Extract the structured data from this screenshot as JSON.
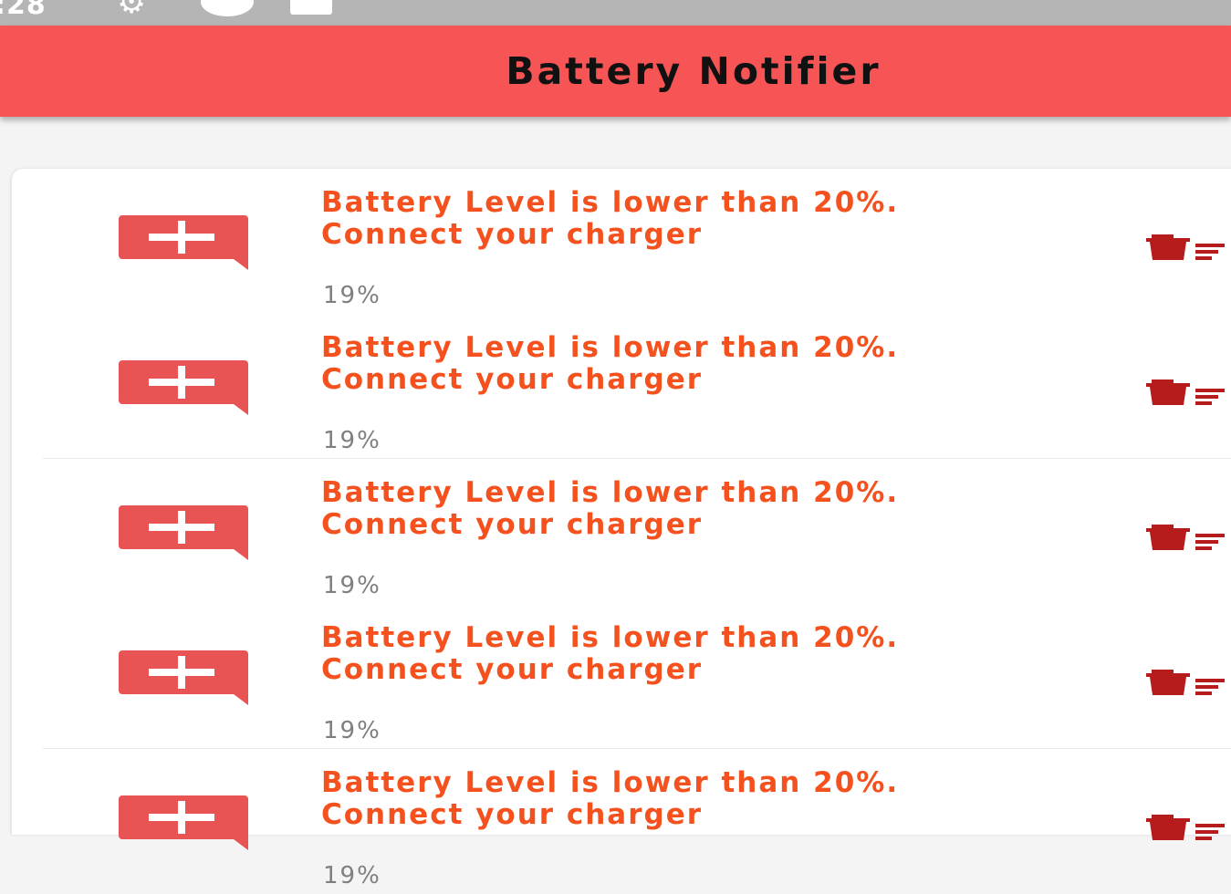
{
  "status_bar": {
    "time": ":28"
  },
  "app_bar": {
    "title": "Battery Notifier"
  },
  "colors": {
    "app_bar": "#f75555",
    "message_text": "#f4511e",
    "alert_icon": "#e85454",
    "delete_icon": "#b71c1c",
    "percent_text": "#7f7f7f"
  },
  "icons": {
    "alert": "add-comment-icon",
    "delete": "delete-sweep-icon"
  },
  "notifications": [
    {
      "message": "Battery Level is lower than 20%. Connect your charger",
      "level": "19%"
    },
    {
      "message": "Battery Level is lower than 20%. Connect your charger",
      "level": "19%"
    },
    {
      "message": "Battery Level is lower than 20%. Connect your charger",
      "level": "19%"
    },
    {
      "message": "Battery Level is lower than 20%. Connect your charger",
      "level": "19%"
    },
    {
      "message": "Battery Level is lower than 20%. Connect your charger",
      "level": "19%"
    }
  ]
}
